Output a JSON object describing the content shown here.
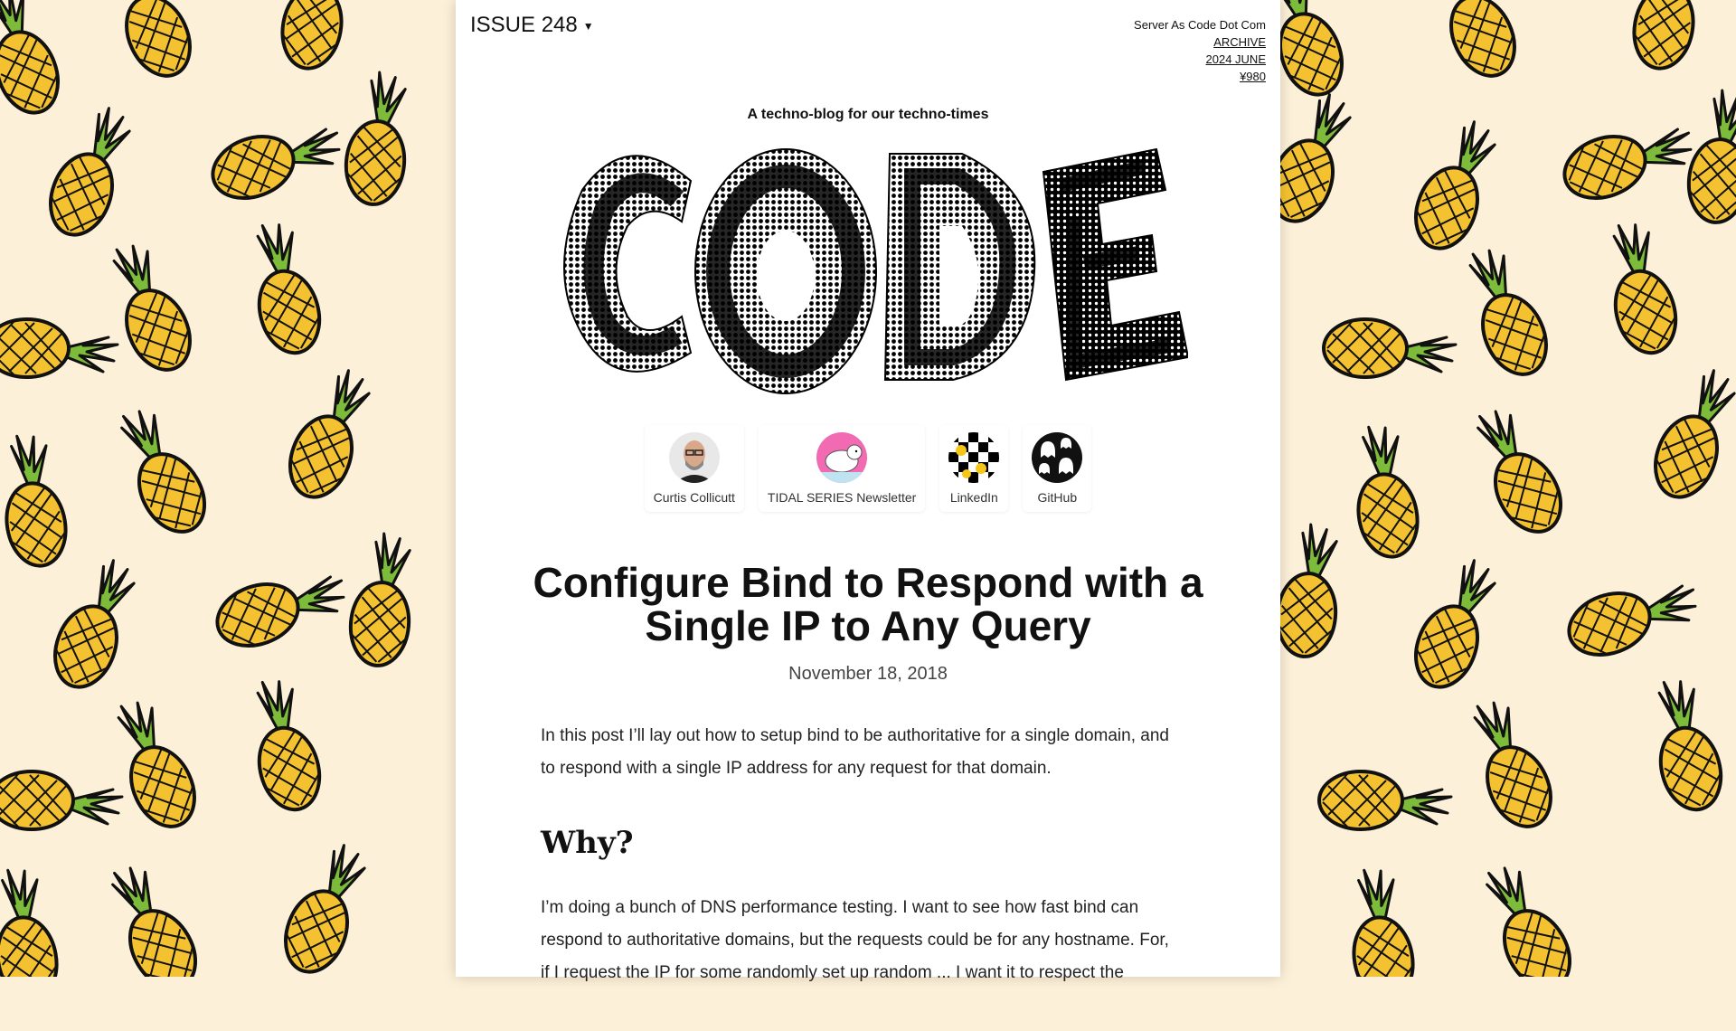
{
  "colors": {
    "background": "#fdf0d8",
    "pineapple_body": "#f4c230",
    "pineapple_leaves": "#7dbb3a",
    "outline": "#111111",
    "paper": "#ffffff"
  },
  "header": {
    "issue": "ISSUE 248",
    "site_name": "Server As Code Dot Com",
    "links": [
      "ARCHIVE",
      "2024 JUNE",
      "¥980"
    ]
  },
  "tagline": "A techno-blog for our techno-times",
  "logo_text": "CODE",
  "socials": [
    {
      "label": "Curtis Collicutt",
      "icon": "avatar-photo"
    },
    {
      "label": "TIDAL SERIES Newsletter",
      "icon": "polar-bear"
    },
    {
      "label": "LinkedIn",
      "icon": "checker-smiley"
    },
    {
      "label": "GitHub",
      "icon": "ghost-pattern"
    }
  ],
  "article": {
    "title": "Configure Bind to Respond with a Single IP to Any Query",
    "date": "November 18, 2018",
    "intro": "In this post I’ll lay out how to setup bind to be authoritative for a single domain, and to respond with a single IP address for any request for that domain.",
    "heading": "Why?",
    "paragraph": "I’m doing a bunch of DNS performance testing. I want to see how fast bind can respond to authoritative domains, but the requests could be for any hostname. For, if I request the IP for some randomly set up random ... I want it to respect the"
  }
}
